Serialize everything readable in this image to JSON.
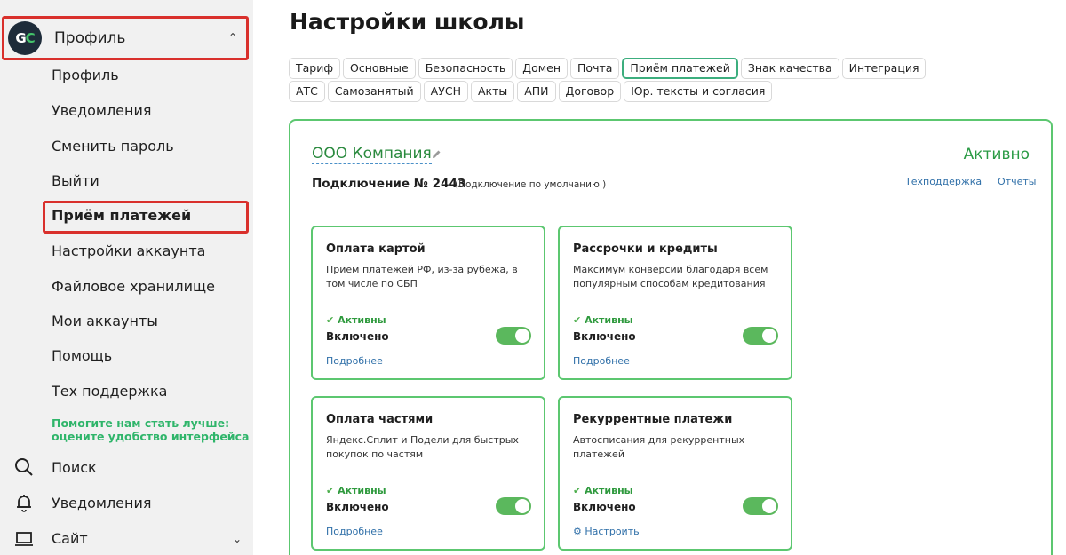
{
  "sidebar": {
    "profile_label": "Профиль",
    "items": [
      {
        "label": "Профиль"
      },
      {
        "label": "Уведомления"
      },
      {
        "label": "Сменить пароль"
      },
      {
        "label": "Выйти"
      },
      {
        "label": "Приём платежей"
      },
      {
        "label": "Настройки аккаунта"
      },
      {
        "label": "Файловое хранилище"
      },
      {
        "label": "Мои аккаунты"
      },
      {
        "label": "Помощь"
      },
      {
        "label": "Тех поддержка"
      }
    ],
    "feedback_line1": "Помогите нам стать лучше:",
    "feedback_line2": "оцените удобство интерфейса",
    "search_label": "Поиск",
    "notifications_label": "Уведомления",
    "site_label": "Сайт"
  },
  "header": {
    "title": "Настройки школы"
  },
  "tabs_row1": [
    "Тариф",
    "Основные",
    "Безопасность",
    "Домен",
    "Почта",
    "Приём платежей",
    "Знак качества",
    "Интеграция"
  ],
  "tabs_row2": [
    "АТС",
    "Самозанятый",
    "АУСН",
    "Акты",
    "АПИ",
    "Договор",
    "Юр. тексты и согласия"
  ],
  "panel": {
    "company": "ООО Компания",
    "status": "Активно",
    "connection": "Подключение № 2443",
    "connection_note": "(Подключение по умолчанию )",
    "support_link": "Техподдержка",
    "reports_link": "Отчеты"
  },
  "cards": [
    {
      "title": "Оплата картой",
      "desc": "Прием платежей РФ, из-за рубежа, в том числе по СБП",
      "status": "Активны",
      "enabled": "Включено",
      "link": "Подробнее"
    },
    {
      "title": "Рассрочки и кредиты",
      "desc": "Максимум конверсии благодаря всем популярным способам кредитования",
      "status": "Активны",
      "enabled": "Включено",
      "link": "Подробнее"
    },
    {
      "title": "Оплата частями",
      "desc": "Яндекс.Сплит и Подели для быстрых покупок по частям",
      "status": "Активны",
      "enabled": "Включено",
      "link": "Подробнее"
    },
    {
      "title": "Рекуррентные платежи",
      "desc": "Автосписания для рекуррентных платежей",
      "status": "Активны",
      "enabled": "Включено",
      "link": "Настроить"
    }
  ],
  "colors": {
    "accent_green": "#5cc770",
    "highlight_red": "#d9302c",
    "link_blue": "#2f6fa8"
  }
}
